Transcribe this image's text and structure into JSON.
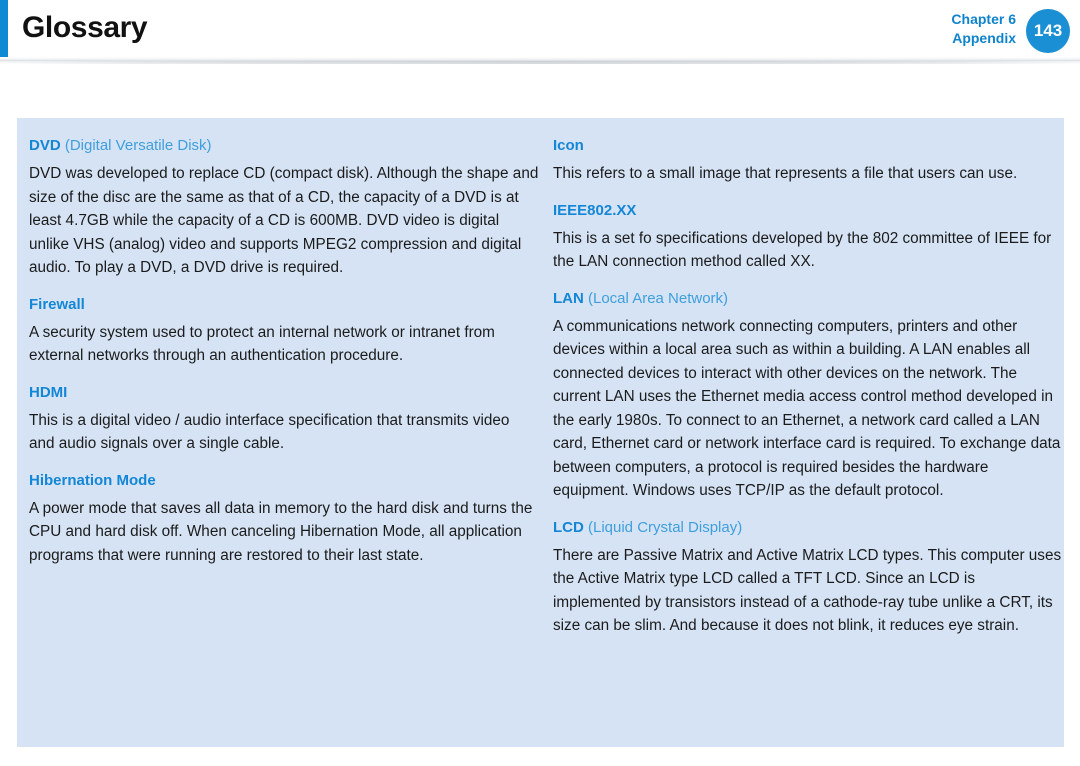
{
  "header": {
    "title": "Glossary",
    "chapter_label": "Chapter 6",
    "section_label": "Appendix",
    "page_number": "143",
    "accent_color": "#0d8ad4",
    "badge_color": "#1a8fd4",
    "title_color": "#111111"
  },
  "panel": {
    "background_color": "#d5e3f4",
    "term_color": "#1486d6",
    "expansion_color": "#3f9fdd",
    "body_color": "#1b1b1b"
  },
  "columns": {
    "left": [
      {
        "term": "DVD",
        "expansion": " (Digital Versatile Disk)",
        "definition": "DVD was developed to replace CD (compact disk). Although the shape and size of the disc are the same as that of a CD, the capacity of a DVD is at least 4.7GB while the capacity of a CD is 600MB. DVD video is digital unlike VHS (analog) video and supports MPEG2 compression and digital audio. To play a DVD, a DVD drive is required."
      },
      {
        "term": "Firewall",
        "expansion": "",
        "definition": "A security system used to protect an internal network or intranet from external networks through an authentication procedure."
      },
      {
        "term": "HDMI",
        "expansion": "",
        "definition": "This is a digital video / audio interface specification that transmits video and audio signals over a single cable."
      },
      {
        "term": "Hibernation Mode",
        "expansion": "",
        "definition": "A power mode that saves all data in memory to the hard disk and turns the CPU and hard disk off. When canceling Hibernation Mode, all application programs that were running are restored to their last state."
      }
    ],
    "right": [
      {
        "term": "Icon",
        "expansion": "",
        "definition": "This refers to a small image that represents a file that users can use."
      },
      {
        "term": "IEEE802.XX",
        "expansion": "",
        "definition": "This is a set fo specifications developed by the 802 committee of IEEE for the LAN connection method called XX."
      },
      {
        "term": "LAN",
        "expansion": " (Local Area Network)",
        "definition": "A communications network connecting computers, printers and other devices within a local area such as within a building. A LAN enables all connected devices to interact with other devices on the network. The current LAN uses the Ethernet media access control method developed in the early 1980s. To connect to an Ethernet, a network card called a LAN card, Ethernet card or network interface card is required. To exchange data between computers, a protocol is required besides the hardware equipment. Windows uses TCP/IP as the default protocol."
      },
      {
        "term": "LCD",
        "expansion": " (Liquid Crystal Display)",
        "definition": "There are Passive Matrix and Active Matrix LCD types. This computer uses the Active Matrix type LCD called a TFT LCD. Since an LCD is implemented by transistors instead of a cathode-ray tube unlike a CRT, its size can be slim. And because it does not blink, it reduces eye strain."
      }
    ]
  }
}
